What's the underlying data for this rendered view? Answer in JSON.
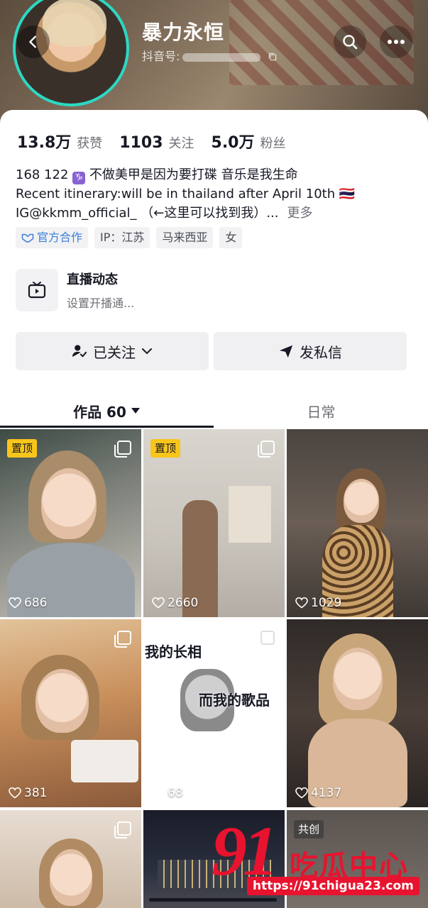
{
  "header": {
    "nickname": "暴力永恒",
    "douyin_id_label": "抖音号:"
  },
  "stats": [
    {
      "value": "13.8万",
      "label": "获赞"
    },
    {
      "value": "1103",
      "label": "关注"
    },
    {
      "value": "5.0万",
      "label": "粉丝"
    }
  ],
  "bio": {
    "line1_prefix": "168 122",
    "zodiac_glyph": "♑",
    "line1_suffix": "不做美甲是因为要打碟 音乐是我生命",
    "line2": "Recent itinerary:will be in thailand after April 10th 🇹🇭",
    "line3": "IG@kkmm_official_ （←这里可以找到我）...",
    "more": "更多"
  },
  "tags": {
    "official": "官方合作",
    "ip": "IP：江苏",
    "region": "马来西亚",
    "gender": "女"
  },
  "live": {
    "title": "直播动态",
    "subtitle": "设置开播通..."
  },
  "buttons": {
    "followed": "已关注",
    "message": "发私信"
  },
  "tabs": {
    "works": "作品 60",
    "daily": "日常"
  },
  "videos": [
    {
      "likes": "686",
      "badge": "置顶"
    },
    {
      "likes": "2660",
      "badge": "置顶"
    },
    {
      "likes": "1029",
      "badge": ""
    },
    {
      "likes": "381",
      "badge": ""
    },
    {
      "likes": "68",
      "badge": "",
      "caption_top": "我的长相",
      "caption_bottom": "而我的歌品"
    },
    {
      "likes": "4137",
      "badge": ""
    },
    {
      "likes": "",
      "badge": ""
    },
    {
      "likes": "",
      "badge": ""
    },
    {
      "likes": "",
      "badge": "共创"
    }
  ],
  "watermark": {
    "number": "91",
    "text": "吃瓜中心",
    "url": "https://91chigua23.com"
  },
  "colors": {
    "avatar_ring": "#2bd9c4",
    "pinned_badge": "#f8c51b",
    "official_tag": "#3b7fd8",
    "watermark": "#e8132e"
  }
}
